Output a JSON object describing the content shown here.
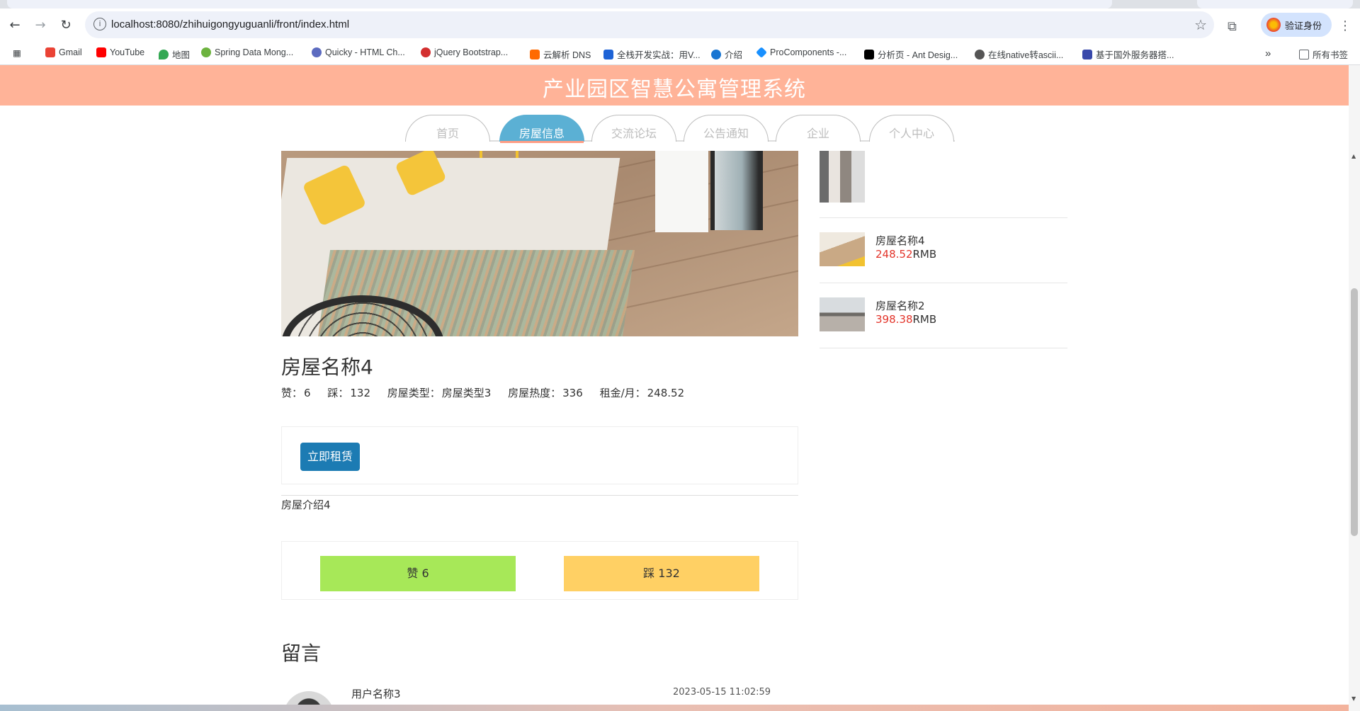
{
  "browser": {
    "url": "localhost:8080/zhihuigongyuguanli/front/index.html",
    "profile_label": "验证身份",
    "bookmarks": [
      {
        "label": "Gmail",
        "color": "#ea4335"
      },
      {
        "label": "YouTube",
        "color": "#ff0000"
      },
      {
        "label": "地图",
        "color": "#34a853"
      },
      {
        "label": "Spring Data Mong...",
        "color": "#6db33f"
      },
      {
        "label": "Quicky - HTML Ch...",
        "color": "#5c6bc0"
      },
      {
        "label": "jQuery Bootstrap...",
        "color": "#d32f2f"
      },
      {
        "label": "云解析 DNS",
        "color": "#ff6a00"
      },
      {
        "label": "全栈开发实战：用V...",
        "color": "#1e63d6"
      },
      {
        "label": "介绍",
        "color": "#1976d2"
      },
      {
        "label": "ProComponents -...",
        "color": "#1890ff"
      },
      {
        "label": "分析页 - Ant Desig...",
        "color": "#000000"
      },
      {
        "label": "在线native转ascii...",
        "color": "#555555"
      },
      {
        "label": "基于国外服务器搭...",
        "color": "#3949ab"
      }
    ],
    "all_bookmarks_label": "所有书签"
  },
  "site": {
    "title": "产业园区智慧公寓管理系统",
    "nav": [
      "首页",
      "房屋信息",
      "交流论坛",
      "公告通知",
      "企业",
      "个人中心"
    ],
    "active_nav": "房屋信息"
  },
  "house": {
    "name": "房屋名称4",
    "likes_label": "赞：",
    "likes": "6",
    "dislikes_label": "踩：",
    "dislikes": "132",
    "type_label": "房屋类型：",
    "type": "房屋类型3",
    "heat_label": "房屋热度：",
    "heat": "336",
    "rent_label": "租金/月：",
    "rent": "248.52",
    "rent_button": "立即租赁",
    "intro": "房屋介绍4",
    "vote_up": "赞  6",
    "vote_down": "踩  132"
  },
  "sidebar": {
    "items": [
      {
        "name": "房屋名称4",
        "price": "248.52",
        "unit": "RMB"
      },
      {
        "name": "房屋名称2",
        "price": "398.38",
        "unit": "RMB"
      }
    ]
  },
  "comments": {
    "title": "留言",
    "items": [
      {
        "user": "用户名称3",
        "time": "2023-05-15 11:02:59"
      }
    ]
  }
}
